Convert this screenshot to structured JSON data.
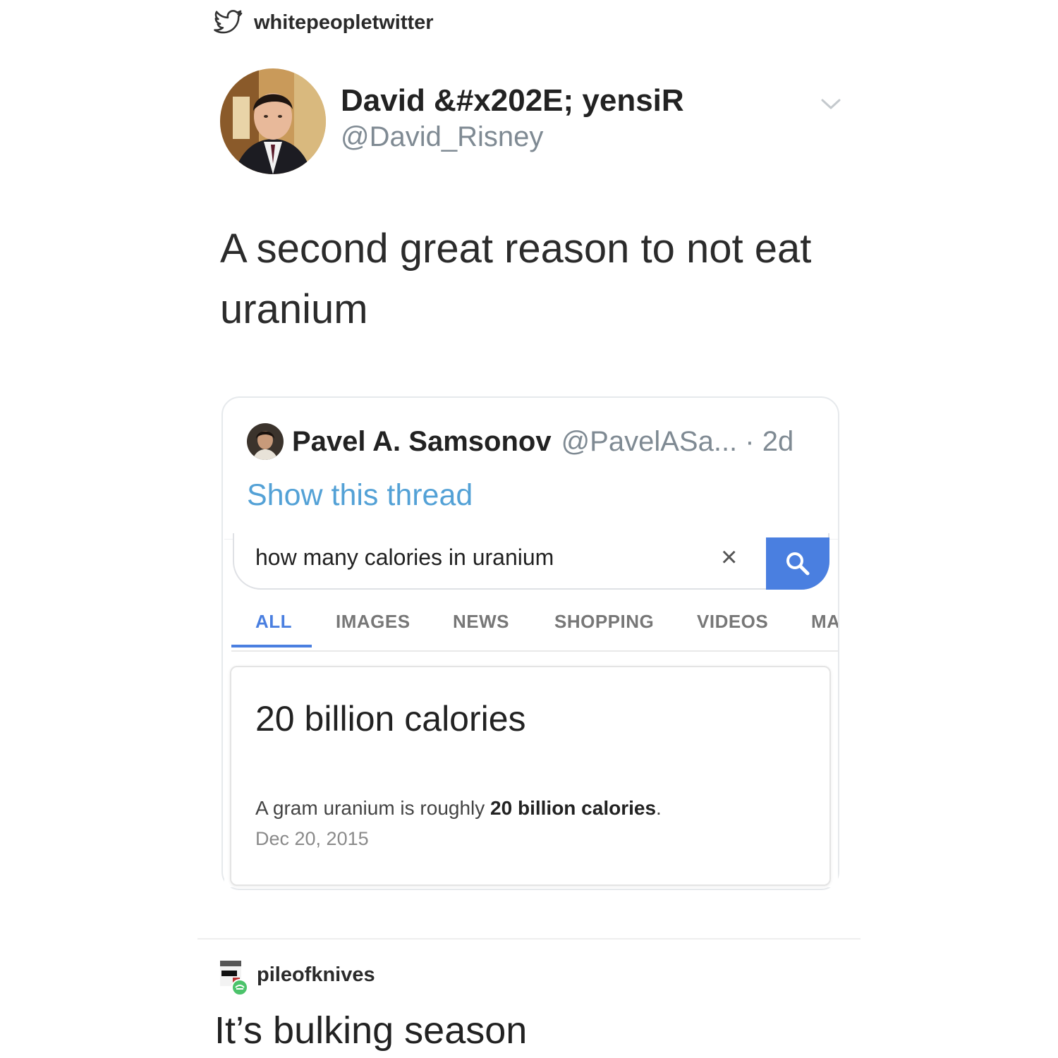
{
  "reblog_source": {
    "icon": "twitter-bird-icon",
    "username": "whitepeopletwitter"
  },
  "tweet": {
    "display_name": "David &#x202E; yensiR",
    "handle": "@David_Risney",
    "text": "A second great reason to not eat uranium",
    "menu_icon": "chevron-down-icon"
  },
  "quoted_tweet": {
    "name": "Pavel A. Samsonov",
    "handle_time": "@PavelASa... · 2d",
    "show_thread": "Show this thread"
  },
  "google": {
    "query": "how many calories in uranium",
    "clear_icon": "×",
    "search_icon": "search-icon",
    "tabs": [
      "ALL",
      "IMAGES",
      "NEWS",
      "SHOPPING",
      "VIDEOS",
      "MA"
    ],
    "active_tab": "ALL",
    "answer": "20 billion calories",
    "snippet_pre": "A gram uranium is roughly ",
    "snippet_bold": "20 billion calories",
    "snippet_post": ".",
    "date": "Dec 20, 2015"
  },
  "reblog": {
    "username": "pileofknives",
    "text": "It’s bulking season"
  },
  "colors": {
    "link_blue": "#53a1d6",
    "google_blue": "#4a7fe0",
    "muted_gray": "#7f8a93"
  }
}
